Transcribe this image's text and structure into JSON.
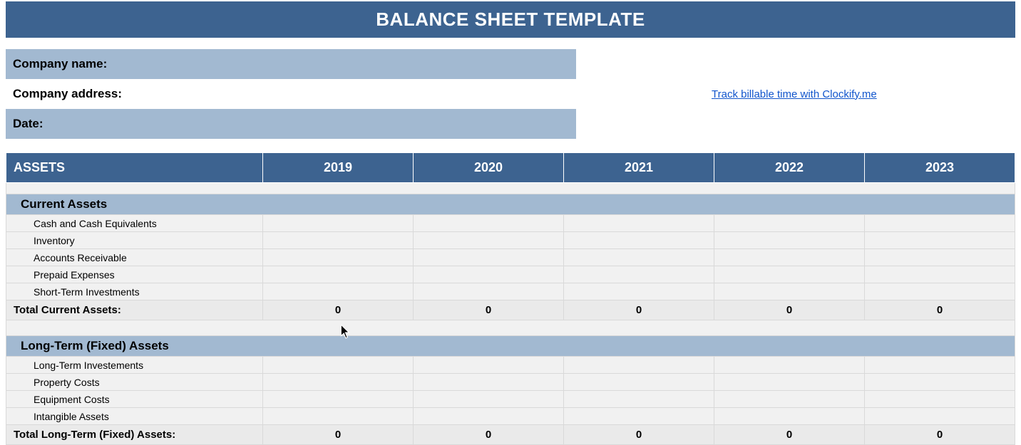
{
  "title": "BALANCE SHEET TEMPLATE",
  "info": {
    "company_name_label": "Company name:",
    "company_address_label": "Company address:",
    "date_label": "Date:"
  },
  "link": {
    "text": "Track billable time with Clockify.me"
  },
  "table": {
    "header_label": "ASSETS",
    "years": [
      "2019",
      "2020",
      "2021",
      "2022",
      "2023"
    ],
    "section1": {
      "title": "Current Assets",
      "items": [
        "Cash and Cash Equivalents",
        "Inventory",
        "Accounts Receivable",
        "Prepaid Expenses",
        "Short-Term Investments"
      ],
      "total_label": "Total Current Assets:",
      "totals": [
        "0",
        "0",
        "0",
        "0",
        "0"
      ]
    },
    "section2": {
      "title": "Long-Term (Fixed) Assets",
      "items": [
        "Long-Term Investements",
        "Property Costs",
        "Equipment Costs",
        "Intangible Assets"
      ],
      "total_label": "Total Long-Term (Fixed) Assets:",
      "totals": [
        "0",
        "0",
        "0",
        "0",
        "0"
      ]
    }
  }
}
